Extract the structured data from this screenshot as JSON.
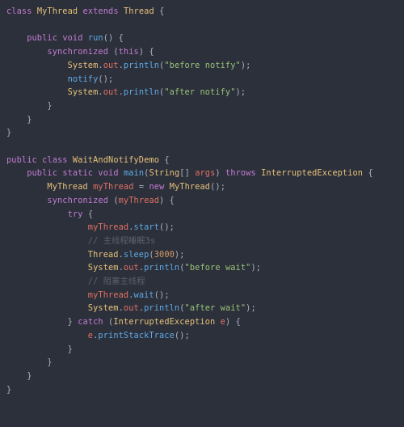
{
  "code": {
    "kw_class": "class",
    "kw_extends": "extends",
    "kw_public": "public",
    "kw_void": "void",
    "kw_synchronized": "synchronized",
    "kw_this": "this",
    "kw_static": "static",
    "kw_throws": "throws",
    "kw_new": "new",
    "kw_try": "try",
    "kw_catch": "catch",
    "t_MyThread": "MyThread",
    "t_Thread": "Thread",
    "t_WaitAndNotifyDemo": "WaitAndNotifyDemo",
    "t_String": "String",
    "t_InterruptedException": "InterruptedException",
    "t_System": "System",
    "m_run": "run",
    "m_println": "println",
    "m_notify": "notify",
    "m_main": "main",
    "m_start": "start",
    "m_sleep": "sleep",
    "m_wait": "wait",
    "m_printStackTrace": "printStackTrace",
    "mem_out": "out",
    "v_myThread": "myThread",
    "v_args": "args",
    "v_e": "e",
    "s_before_notify": "\"before notify\"",
    "s_after_notify": "\"after notify\"",
    "s_before_wait": "\"before wait\"",
    "s_after_wait": "\"after wait\"",
    "n_3000": "3000",
    "c_sleep3s": "// 主线程睡眠3s",
    "c_blockmain": "// 阻塞主线程",
    "p_open_brace": "{",
    "p_close_brace": "}",
    "p_open_paren": "(",
    "p_close_paren": ")",
    "p_open_bracket": "[",
    "p_close_bracket": "]",
    "p_semi": ";",
    "p_dot": ".",
    "p_eq": "=",
    "p_sp": " "
  }
}
